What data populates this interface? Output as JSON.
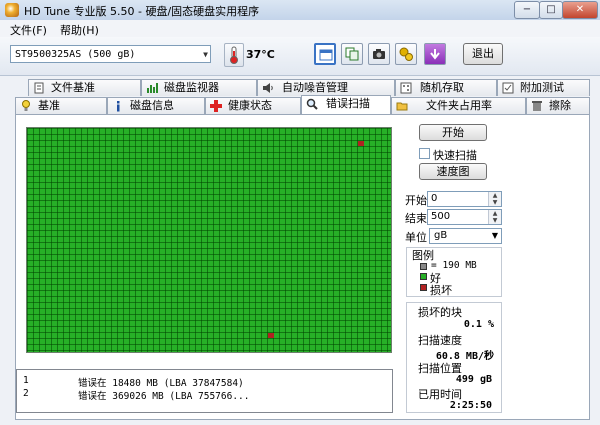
{
  "window": {
    "title": "HD Tune 专业版 5.50 - 硬盘/固态硬盘实用程序",
    "minimize": "−",
    "maximize": "□",
    "close": "✕"
  },
  "menu": {
    "file": "文件(F)",
    "help": "帮助(H)"
  },
  "toolbar": {
    "drive": "ST9500325AS (500 gB)",
    "temperature": "37°C",
    "exit_label": "退出",
    "icons": [
      "thermometer-icon",
      "window-icon",
      "copy-icon",
      "camera-icon",
      "options-icon",
      "save-icon"
    ]
  },
  "tabs_top": [
    {
      "label": "文件基准",
      "icon": "file-benchmark-icon"
    },
    {
      "label": "磁盘监视器",
      "icon": "disk-monitor-icon"
    },
    {
      "label": "自动噪音管理",
      "icon": "speaker-icon"
    },
    {
      "label": "随机存取",
      "icon": "random-access-icon"
    },
    {
      "label": "附加测试",
      "icon": "extra-tests-icon"
    }
  ],
  "tabs_bottom": [
    {
      "label": "基准",
      "icon": "benchmark-icon"
    },
    {
      "label": "磁盘信息",
      "icon": "info-icon"
    },
    {
      "label": "健康状态",
      "icon": "health-icon"
    },
    {
      "label": "错误扫描",
      "icon": "error-scan-icon",
      "selected": true
    },
    {
      "label": "文件夹占用率",
      "icon": "folder-icon"
    },
    {
      "label": "擦除",
      "icon": "erase-icon"
    }
  ],
  "scan": {
    "bad_blocks": [
      {
        "row": 2,
        "col": 55
      },
      {
        "row": 34,
        "col": 40
      }
    ],
    "grid_rows": 45,
    "grid_cols": 61
  },
  "log": [
    {
      "num": "1",
      "text": "错误在 18480 MB (LBA 37847584)"
    },
    {
      "num": "2",
      "text": "错误在 369026 MB (LBA 755766..."
    }
  ],
  "controls": {
    "start_button": "开始",
    "quick_scan": "快速扫描",
    "quick_scan_checked": false,
    "speed_button": "速度图",
    "start_label": "开始",
    "start_value": "0",
    "end_label": "结束",
    "end_value": "500",
    "unit_label": "单位",
    "unit_value": "gB"
  },
  "legend": {
    "title": "图例",
    "block_size": "= 190 MB",
    "good": "好",
    "bad": "损坏",
    "colors": {
      "good": "#27b027",
      "bad": "#b22222",
      "unit": "#888888"
    }
  },
  "stats": {
    "damaged_label": "损坏的块",
    "damaged_value": "0.1 %",
    "speed_label": "扫描速度",
    "speed_value": "60.8 MB/秒",
    "position_label": "扫描位置",
    "position_value": "499 gB",
    "elapsed_label": "已用时间",
    "elapsed_value": "2:25:50"
  }
}
